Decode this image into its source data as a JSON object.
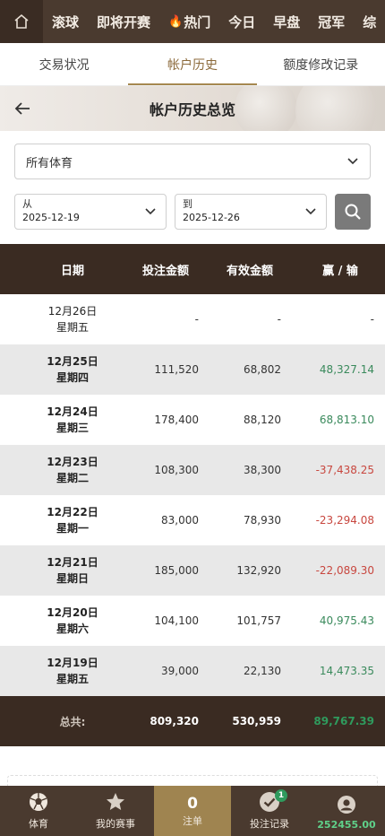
{
  "topnav": {
    "items": [
      "滚球",
      "即将开赛",
      "热门",
      "今日",
      "早盘",
      "冠军",
      "综"
    ]
  },
  "tabs": [
    "交易状况",
    "帐户历史",
    "额度修改记录"
  ],
  "banner": {
    "title": "帐户历史总览"
  },
  "filters": {
    "sport": "所有体育",
    "from_label": "从",
    "from_value": "2025-12-19",
    "to_label": "到",
    "to_value": "2025-12-26"
  },
  "table": {
    "headers": [
      "日期",
      "投注金额",
      "有效金额",
      "赢 / 输"
    ],
    "rows": [
      {
        "date": "12月26日",
        "day": "星期五",
        "bet": "-",
        "valid": "-",
        "winloss": "-",
        "sign": "none"
      },
      {
        "date": "12月25日",
        "day": "星期四",
        "bet": "111,520",
        "valid": "68,802",
        "winloss": "48,327.14",
        "sign": "pos"
      },
      {
        "date": "12月24日",
        "day": "星期三",
        "bet": "178,400",
        "valid": "88,120",
        "winloss": "68,813.10",
        "sign": "pos"
      },
      {
        "date": "12月23日",
        "day": "星期二",
        "bet": "108,300",
        "valid": "38,300",
        "winloss": "-37,438.25",
        "sign": "neg"
      },
      {
        "date": "12月22日",
        "day": "星期一",
        "bet": "83,000",
        "valid": "78,930",
        "winloss": "-23,294.08",
        "sign": "neg"
      },
      {
        "date": "12月21日",
        "day": "星期日",
        "bet": "185,000",
        "valid": "132,920",
        "winloss": "-22,089.30",
        "sign": "neg"
      },
      {
        "date": "12月20日",
        "day": "星期六",
        "bet": "104,100",
        "valid": "101,757",
        "winloss": "40,975.43",
        "sign": "pos"
      },
      {
        "date": "12月19日",
        "day": "星期五",
        "bet": "39,000",
        "valid": "22,130",
        "winloss": "14,473.35",
        "sign": "pos"
      }
    ],
    "total": {
      "label": "总共:",
      "bet": "809,320",
      "valid": "530,959",
      "winloss": "89,767.39"
    }
  },
  "bottombar": {
    "sports": "体育",
    "my_events": "我的赛事",
    "bet_count": "0",
    "bet_slip": "注单",
    "bet_records": "投注记录",
    "bet_records_badge": "1",
    "balance": "252455.00"
  },
  "colors": {
    "nav_bg": "#4a3a2f",
    "table_header_bg": "#3a2b22",
    "accent": "#a58850",
    "positive": "#3a8a5c",
    "negative": "#c8473f"
  }
}
